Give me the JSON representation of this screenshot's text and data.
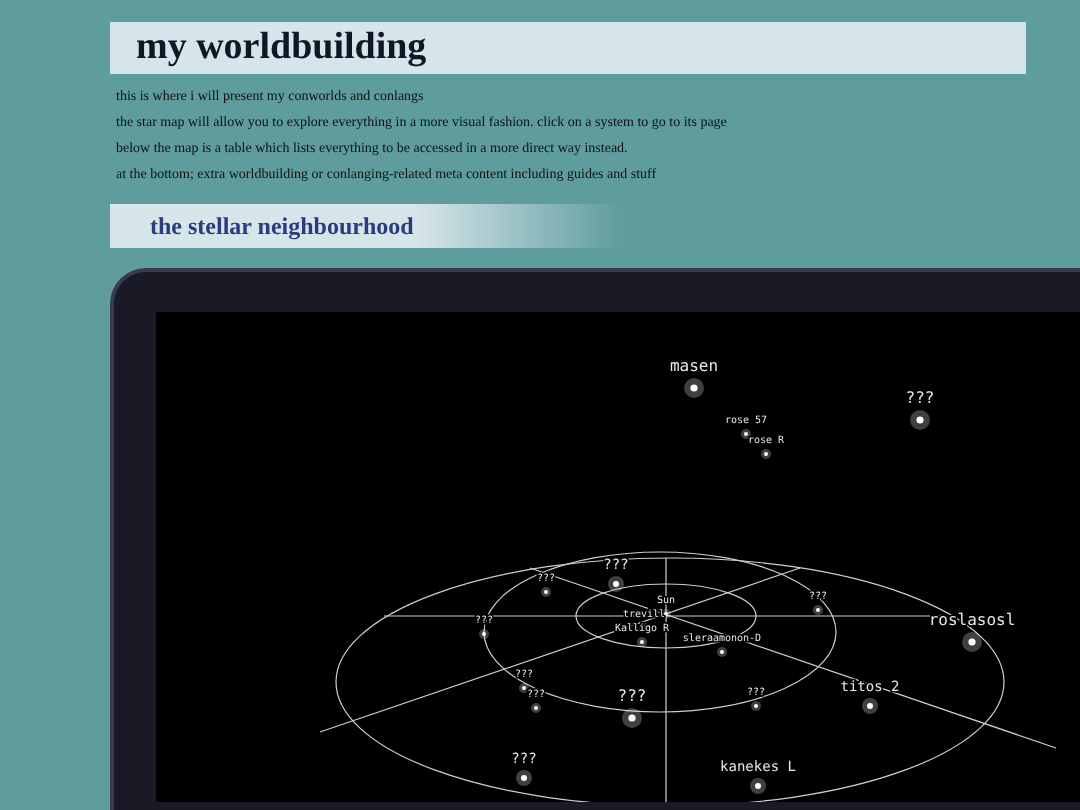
{
  "header": {
    "title": "my worldbuilding"
  },
  "intro": [
    "this is where i will present my conworlds and conlangs",
    "the star map will allow you to explore everything in a more visual fashion. click on a system to go to its page",
    "below the map is a table which lists everything to be accessed in a more direct way instead.",
    "at the bottom; extra worldbuilding or conlanging-related meta content including guides and stuff"
  ],
  "section": {
    "title": "the stellar neighbourhood"
  },
  "star_map": {
    "stars": [
      {
        "label": "masen",
        "kind": "big"
      },
      {
        "label": "rose 57",
        "kind": "tiny"
      },
      {
        "label": "rose R",
        "kind": "tiny"
      },
      {
        "label": "???",
        "kind": "big"
      },
      {
        "label": "???",
        "kind": "small"
      },
      {
        "label": "???",
        "kind": "tiny"
      },
      {
        "label": "Sun",
        "kind": "tiny"
      },
      {
        "label": "trevill",
        "kind": "tiny"
      },
      {
        "label": "Kalligo R",
        "kind": "tiny"
      },
      {
        "label": "???",
        "kind": "tiny"
      },
      {
        "label": "???",
        "kind": "tiny"
      },
      {
        "label": "sleraamonon-D",
        "kind": "tiny"
      },
      {
        "label": "roslasosl",
        "kind": "big"
      },
      {
        "label": "???",
        "kind": "tiny"
      },
      {
        "label": "???",
        "kind": "tiny"
      },
      {
        "label": "???",
        "kind": "big"
      },
      {
        "label": "???",
        "kind": "tiny"
      },
      {
        "label": "titos 2",
        "kind": "small"
      },
      {
        "label": "???",
        "kind": "small"
      },
      {
        "label": "kanekes L",
        "kind": "small"
      }
    ]
  }
}
